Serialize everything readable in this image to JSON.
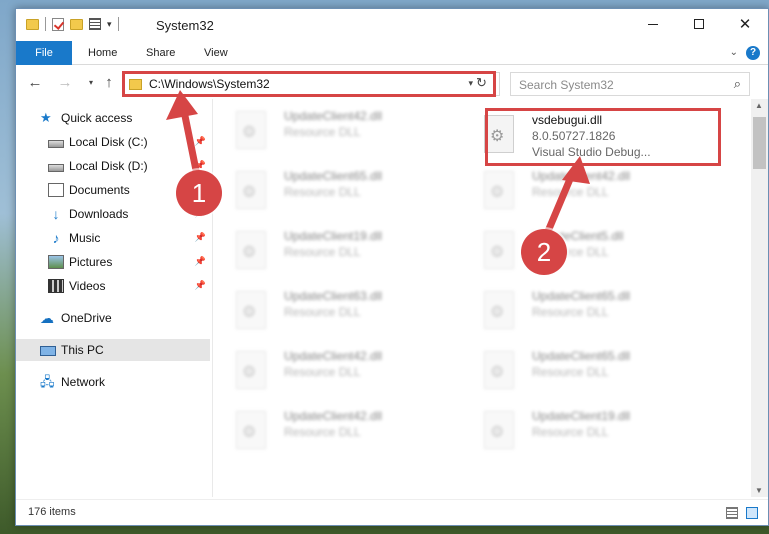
{
  "window": {
    "title": "System32",
    "minimize_icon": "minimize-icon",
    "maximize_icon": "maximize-icon",
    "close_glyph": "✕"
  },
  "ribbon": {
    "tabs": [
      {
        "label": "File"
      },
      {
        "label": "Home"
      },
      {
        "label": "Share"
      },
      {
        "label": "View"
      }
    ],
    "help_label": "?"
  },
  "nav": {
    "back": "←",
    "forward": "→",
    "dropdown": "▾",
    "up": "↑",
    "address": "C:\\Windows\\System32",
    "address_dropdown": "▾",
    "refresh": "↻",
    "search_placeholder": "Search System32",
    "search_glyph": "⌕"
  },
  "sidebar": {
    "items": [
      {
        "label": "Quick access",
        "icon": "star-icon",
        "pinned": false
      },
      {
        "label": "Local Disk (C:)",
        "icon": "drive-icon",
        "pinned": true
      },
      {
        "label": "Local Disk (D:)",
        "icon": "drive-icon",
        "pinned": true
      },
      {
        "label": "Documents",
        "icon": "documents-icon",
        "pinned": true
      },
      {
        "label": "Downloads",
        "icon": "downloads-icon",
        "pinned": true
      },
      {
        "label": "Music",
        "icon": "music-icon",
        "pinned": true
      },
      {
        "label": "Pictures",
        "icon": "pictures-icon",
        "pinned": true
      },
      {
        "label": "Videos",
        "icon": "videos-icon",
        "pinned": true
      },
      {
        "label": "OneDrive",
        "icon": "onedrive-icon",
        "pinned": false
      },
      {
        "label": "This PC",
        "icon": "this-pc-icon",
        "pinned": false,
        "selected": true
      },
      {
        "label": "Network",
        "icon": "network-icon",
        "pinned": false
      }
    ]
  },
  "files": {
    "target": {
      "name": "vsdebugui.dll",
      "version": "8.0.50727.1826",
      "description": "Visual Studio Debug..."
    },
    "col1": [
      {
        "name": "UpdateClient42.dll",
        "type": "Resource DLL"
      },
      {
        "name": "UpdateClient65.dll",
        "type": "Resource DLL"
      },
      {
        "name": "UpdateClient19.dll",
        "type": "Resource DLL"
      },
      {
        "name": "UpdateClient63.dll",
        "type": "Resource DLL"
      },
      {
        "name": "UpdateClient42.dll",
        "type": "Resource DLL"
      },
      {
        "name": "UpdateClient42.dll",
        "type": "Resource DLL"
      }
    ],
    "col2": [
      {
        "name": "UpdateClient42.dll",
        "type": "Resource DLL"
      },
      {
        "name": "UpdateClient5.dll",
        "type": "Resource DLL"
      },
      {
        "name": "UpdateClient65.dll",
        "type": "Resource DLL"
      },
      {
        "name": "UpdateClient65.dll",
        "type": "Resource DLL"
      },
      {
        "name": "UpdateClient19.dll",
        "type": "Resource DLL"
      }
    ]
  },
  "status": {
    "item_count": "176 items"
  },
  "callouts": [
    {
      "number": "1"
    },
    {
      "number": "2"
    }
  ],
  "colors": {
    "accent": "#1979ca",
    "highlight": "#d64545"
  }
}
